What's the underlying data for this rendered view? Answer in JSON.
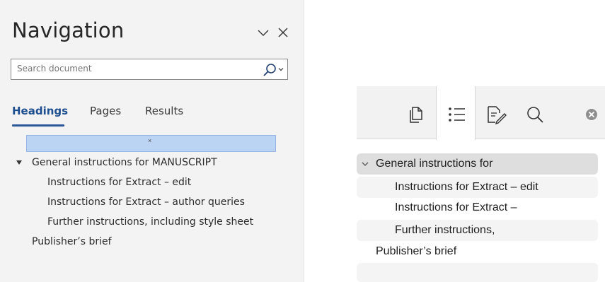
{
  "navigation": {
    "title": "Navigation",
    "search": {
      "placeholder": "Search document"
    },
    "tabs": [
      {
        "label": "Headings",
        "active": true
      },
      {
        "label": "Pages",
        "active": false
      },
      {
        "label": "Results",
        "active": false
      }
    ],
    "placeholder_mark": "×",
    "headings": [
      {
        "label": "General instructions for MANUSCRIPT",
        "level": 1,
        "expanded": true
      },
      {
        "label": "Instructions for Extract – edit",
        "level": 2
      },
      {
        "label": "Instructions for Extract – author queries",
        "level": 2
      },
      {
        "label": "Further instructions, including style sheet",
        "level": 2
      },
      {
        "label": "Publisher’s brief",
        "level": 1
      }
    ],
    "accent_color": "#2b579a"
  },
  "sidebar": {
    "tools": [
      "pages-icon",
      "list-icon",
      "document-edit-icon",
      "search-icon",
      "close-icon"
    ],
    "headings": [
      {
        "label": "General instructions for",
        "level": 1,
        "expanded": true,
        "selected": true
      },
      {
        "label": "Instructions for Extract – edit",
        "level": 2
      },
      {
        "label": "Instructions for Extract –",
        "level": 2
      },
      {
        "label": "Further instructions,",
        "level": 2
      },
      {
        "label": "Publisher’s brief",
        "level": 1
      }
    ]
  }
}
